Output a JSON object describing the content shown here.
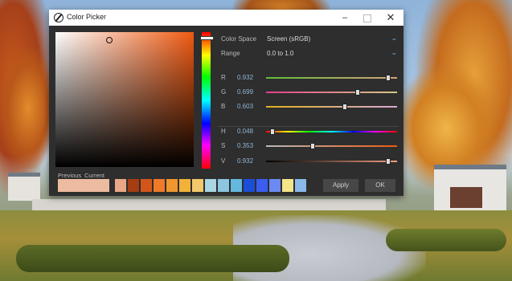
{
  "window": {
    "title": "Color Picker"
  },
  "controls": {
    "minimize": "–",
    "maximize": "",
    "close": "✕"
  },
  "color_space": {
    "label": "Color Space",
    "value": "Screen (sRGB)"
  },
  "range": {
    "label": "Range",
    "value": "0.0 to 1.0"
  },
  "channels": [
    {
      "label": "R",
      "value": "0.932",
      "level": 0.932,
      "gradient": "linear-gradient(to right,#5fbf3a,#d6a07a)"
    },
    {
      "label": "G",
      "value": "0.699",
      "level": 0.699,
      "gradient": "linear-gradient(to right,#e2408c,#d6ca8a)"
    },
    {
      "label": "B",
      "value": "0.603",
      "level": 0.603,
      "gradient": "linear-gradient(to right,#e0b020,#d8a8d0)"
    },
    {
      "label": "H",
      "value": "0.048",
      "level": 0.048,
      "gradient": "linear-gradient(to right,#ff0000,#ffff00,#00ff00,#00ffff,#0000ff,#ff00ff,#ff0000)"
    },
    {
      "label": "S",
      "value": "0.353",
      "level": 0.353,
      "gradient": "linear-gradient(to right,#b8b8b8,#f05a12)"
    },
    {
      "label": "V",
      "value": "0.932",
      "level": 0.932,
      "gradient": "linear-gradient(to right,#000000,#f0a080)"
    }
  ],
  "preview": {
    "previous_label": "Previous",
    "current_label": "Current",
    "current_color": "#edbba0",
    "previous_color": "#edbba0"
  },
  "swatches": [
    "#e8a888",
    "#a63c12",
    "#d2561a",
    "#f07a28",
    "#f0962e",
    "#f2b23a",
    "#f4c86a",
    "#a8d6e2",
    "#8cc6e0",
    "#64b8de",
    "#1a4ed8",
    "#3a5ef0",
    "#6a8af2",
    "#f4e48a",
    "#8ab8e8"
  ],
  "buttons": {
    "apply": "Apply",
    "ok": "OK"
  },
  "accent": "#6aa8e0"
}
